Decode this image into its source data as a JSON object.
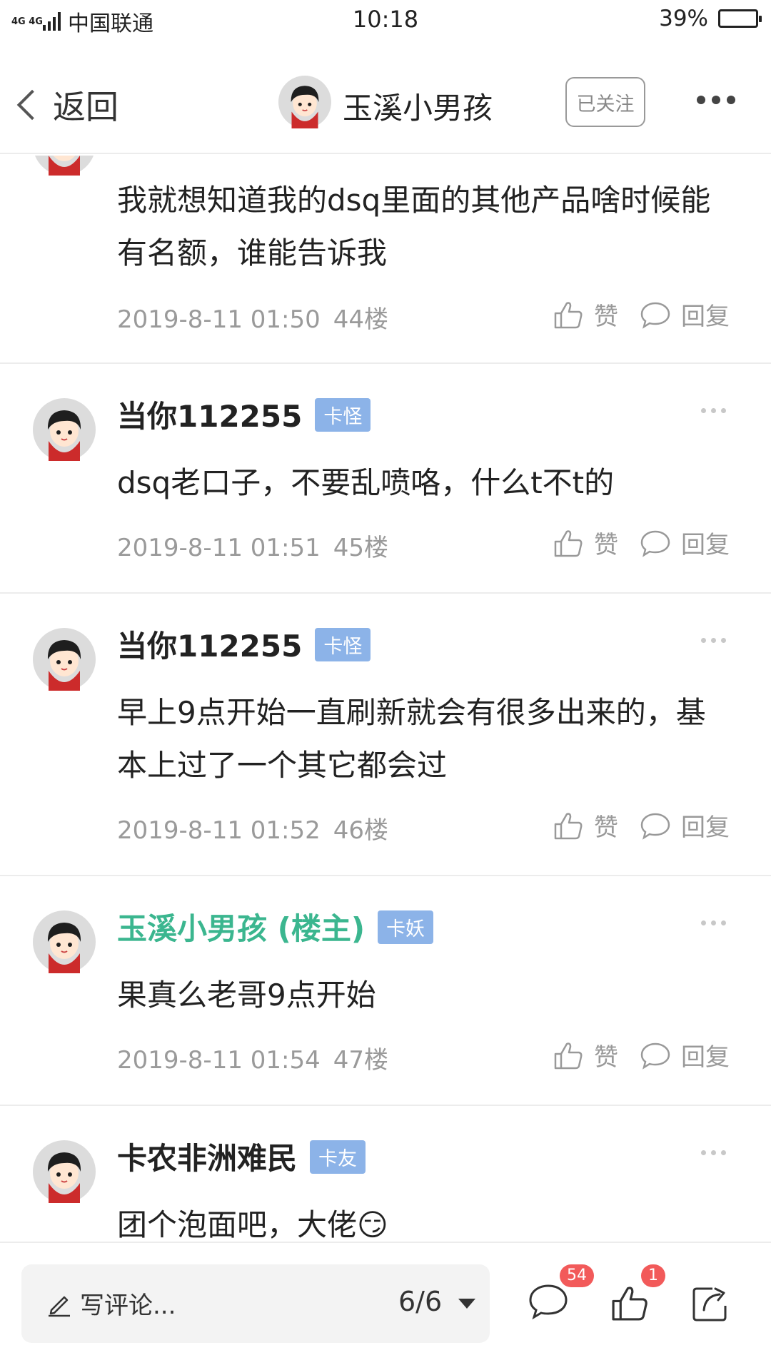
{
  "status_bar": {
    "network": "4G 4G",
    "carrier": "中国联通",
    "time": "10:18",
    "battery_pct": "39%",
    "battery_level": 0.39
  },
  "nav": {
    "back_label": "返回",
    "thread_owner": "玉溪小男孩",
    "follow_label": "已关注"
  },
  "posts": [
    {
      "text": "我就想知道我的dsq里面的其他产品啥时候能有名额，谁能告诉我",
      "date": "2019-8-11 01:50",
      "floor": "44楼",
      "like": "赞",
      "reply": "回复"
    },
    {
      "user": "当你112255",
      "badge": "卡怪",
      "text": "dsq老口子，不要乱喷咯，什么t不t的",
      "date": "2019-8-11 01:51",
      "floor": "45楼",
      "like": "赞",
      "reply": "回复"
    },
    {
      "user": "当你112255",
      "badge": "卡怪",
      "text": "早上9点开始一直刷新就会有很多出来的，基本上过了一个其它都会过",
      "date": "2019-8-11 01:52",
      "floor": "46楼",
      "like": "赞",
      "reply": "回复"
    },
    {
      "user": "玉溪小男孩 (楼主)",
      "badge": "卡妖",
      "text": "果真么老哥9点开始",
      "date": "2019-8-11 01:54",
      "floor": "47楼",
      "like": "赞",
      "reply": "回复"
    },
    {
      "user": "卡农非洲难民",
      "badge": "卡友",
      "text": "团个泡面吧，大佬",
      "emoji": "😏"
    }
  ],
  "bottom": {
    "comment_placeholder": "写评论...",
    "page_indicator": "6/6",
    "comment_count": "54",
    "like_count": "1"
  },
  "colors": {
    "op_name": "#3bb68f",
    "badge_bg": "#8cb3e8",
    "count_badge": "#f25a5a",
    "battery": "#3cc95c"
  }
}
